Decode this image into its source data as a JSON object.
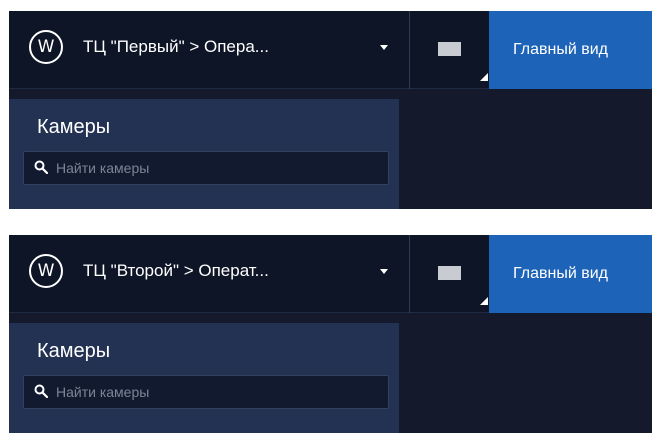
{
  "colors": {
    "topbar_bg": "#0d1526",
    "workspace_bg": "#141a2b",
    "sidebar_bg": "#233152",
    "search_bg": "#111a2e",
    "accent_tab": "#1d63b8",
    "text_primary": "#ffffff",
    "placeholder_text": "#7d8498"
  },
  "panels": [
    {
      "logo_letter": "W",
      "site_title": "ТЦ \"Первый\" > Опера...",
      "main_view_tab": "Главный вид",
      "sidebar_title": "Камеры",
      "search_placeholder": "Найти камеры",
      "search_value": ""
    },
    {
      "logo_letter": "W",
      "site_title": "ТЦ \"Второй\" > Операт...",
      "main_view_tab": "Главный вид",
      "sidebar_title": "Камеры",
      "search_placeholder": "Найти камеры",
      "search_value": ""
    }
  ],
  "icons": {
    "logo": "w-logo-icon",
    "dropdown": "chevron-down-icon",
    "layout": "layout-screen-icon",
    "search": "search-icon"
  }
}
